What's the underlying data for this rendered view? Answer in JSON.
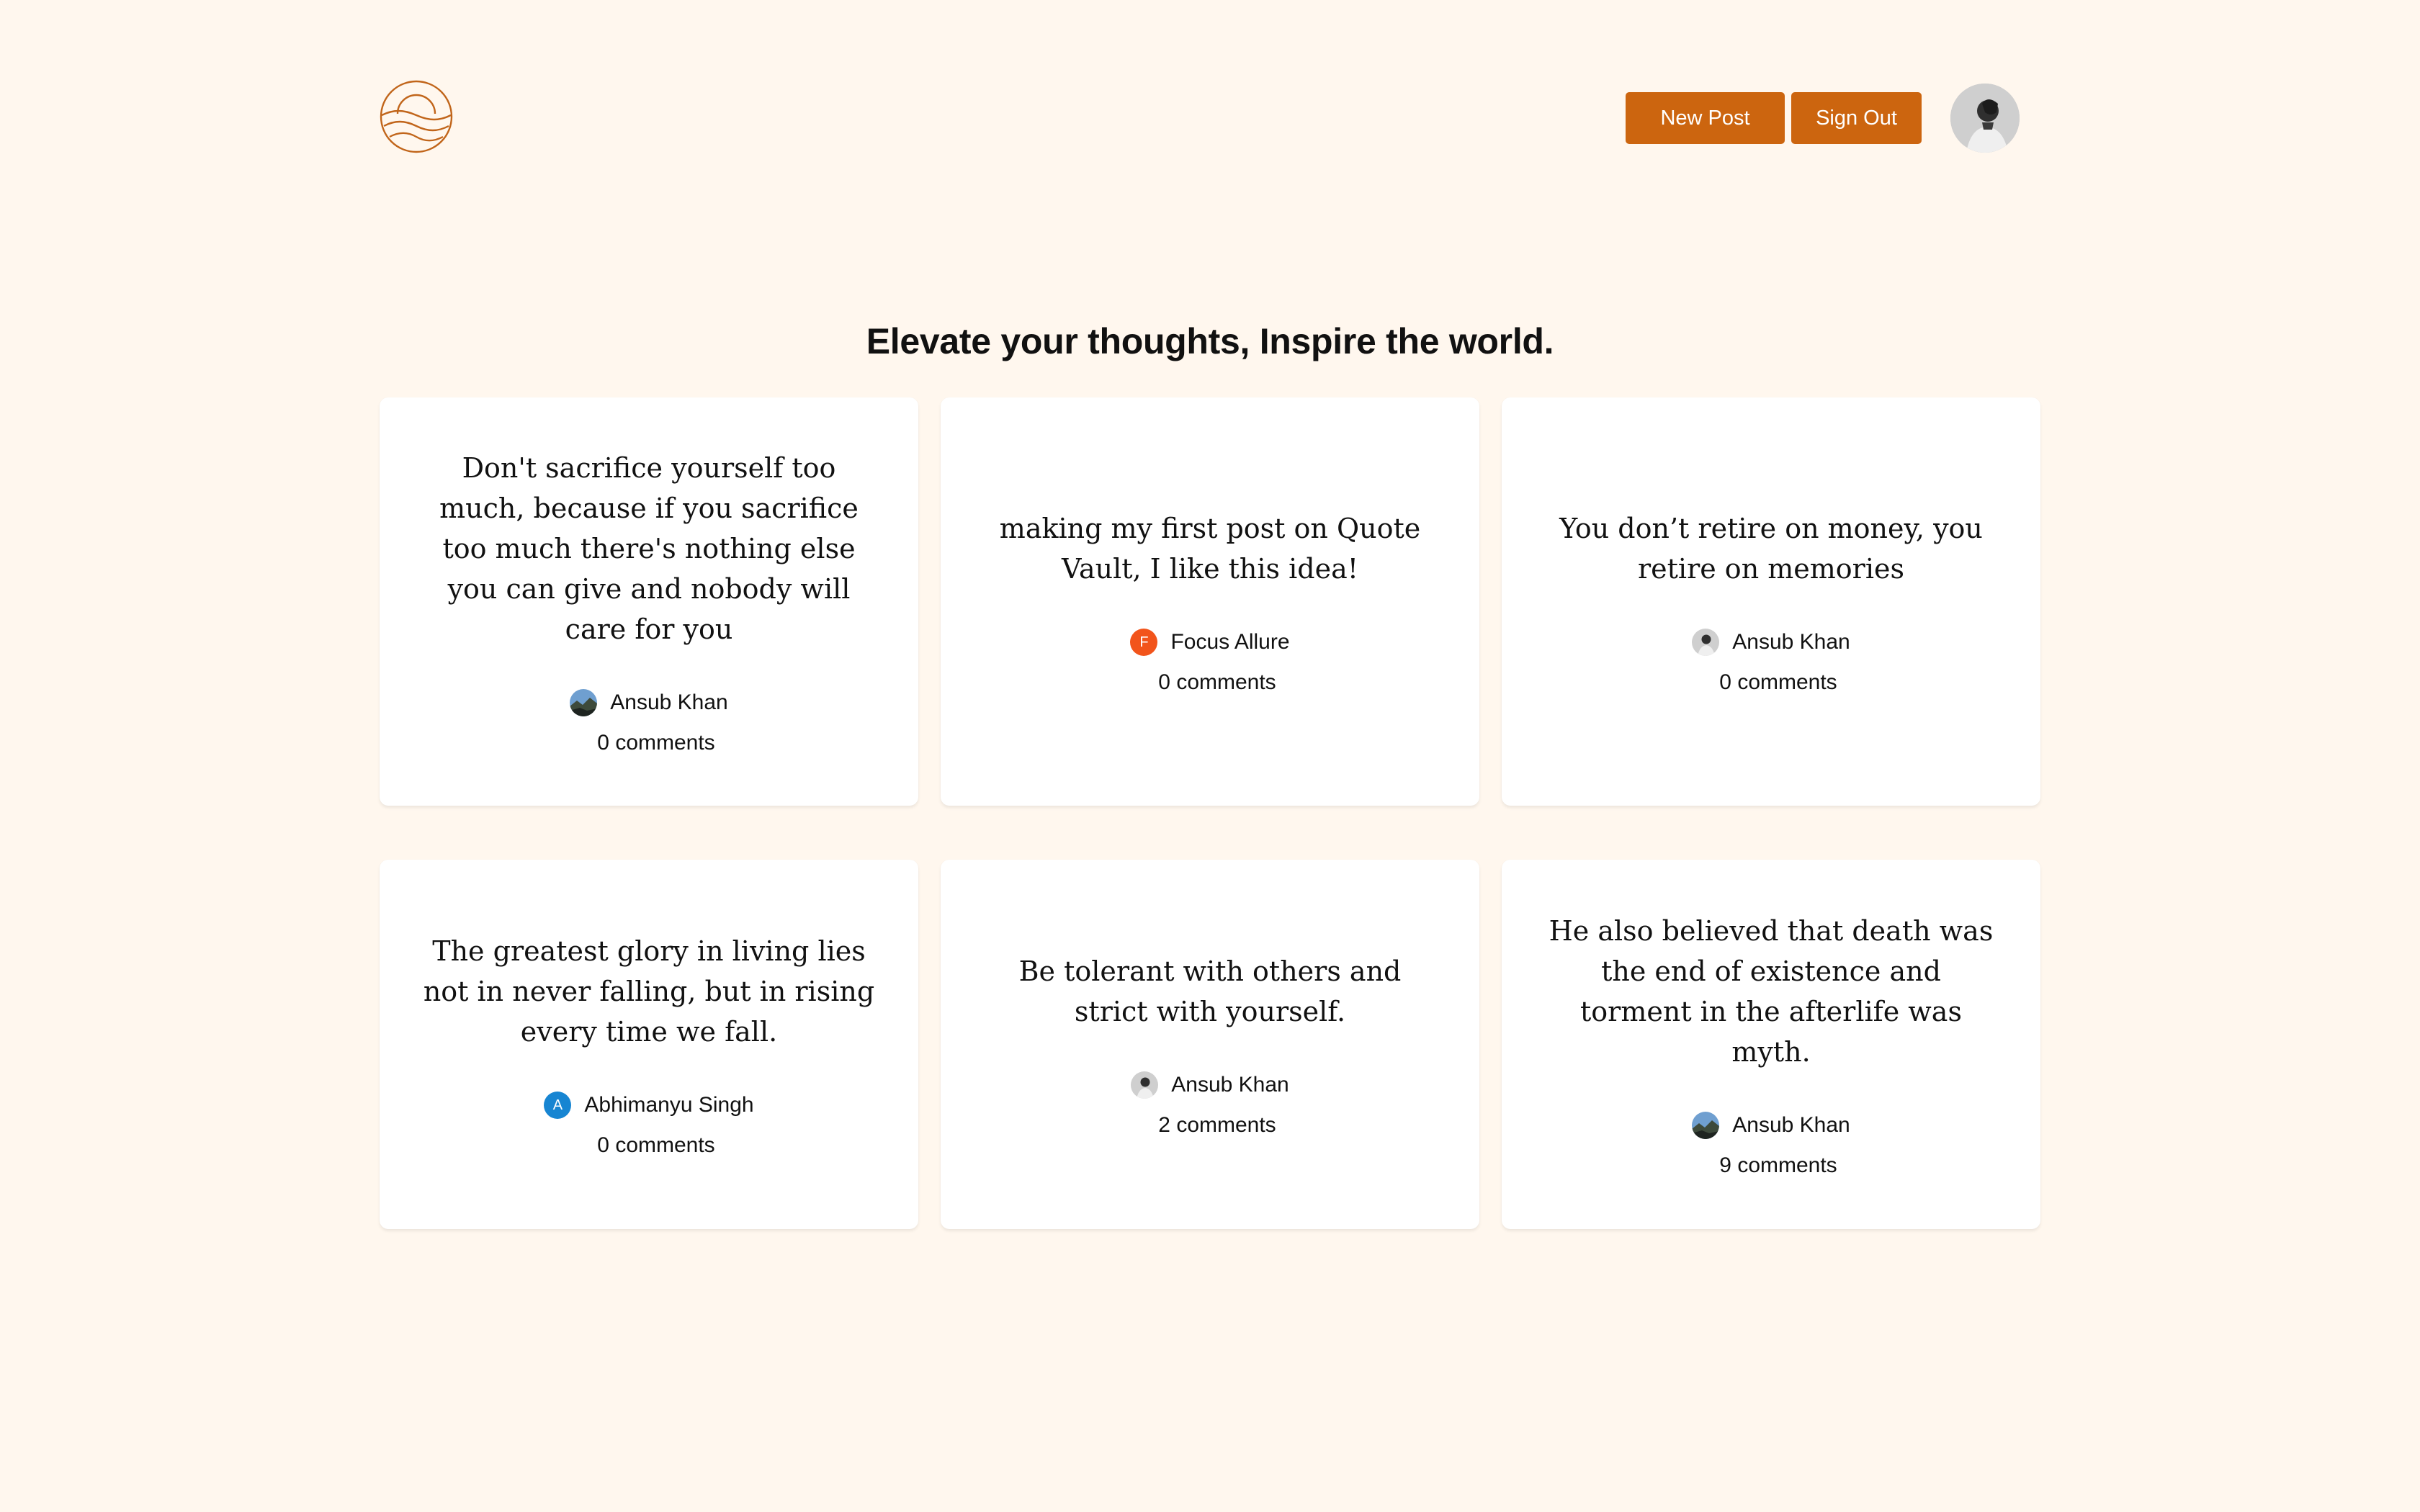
{
  "header": {
    "logo_icon": "sun-over-waves-icon",
    "new_post_label": "New Post",
    "sign_out_label": "Sign Out",
    "avatar_icon": "user-avatar",
    "accent_color": "#cc650f"
  },
  "hero": {
    "title": "Elevate your thoughts, Inspire the world."
  },
  "posts": [
    {
      "quote": "Don't sacrifice yourself too much, because if you sacrifice too much there's nothing else you can give and nobody will care for you",
      "author": "Ansub Khan",
      "avatar_type": "landscape-photo",
      "comments": "0 comments"
    },
    {
      "quote": "making my first post on Quote Vault, I like this idea!",
      "author": "Focus Allure",
      "avatar_type": "letter",
      "avatar_letter": "F",
      "avatar_color": "#f2541b",
      "comments": "0 comments"
    },
    {
      "quote": "You don’t retire on money, you retire on memories",
      "author": "Ansub Khan",
      "avatar_type": "portrait-photo",
      "comments": "0 comments"
    },
    {
      "quote": "The greatest glory in living lies not in never falling, but in rising every time we fall.",
      "author": "Abhimanyu Singh",
      "avatar_type": "letter",
      "avatar_letter": "A",
      "avatar_color": "#1785d2",
      "comments": "0 comments"
    },
    {
      "quote": "Be tolerant with others and strict with yourself.",
      "author": "Ansub Khan",
      "avatar_type": "portrait-photo",
      "comments": "2 comments"
    },
    {
      "quote": "He also believed that death was the end of existence and torment in the afterlife was myth.",
      "author": "Ansub Khan",
      "avatar_type": "landscape-photo",
      "comments": "9 comments"
    }
  ]
}
